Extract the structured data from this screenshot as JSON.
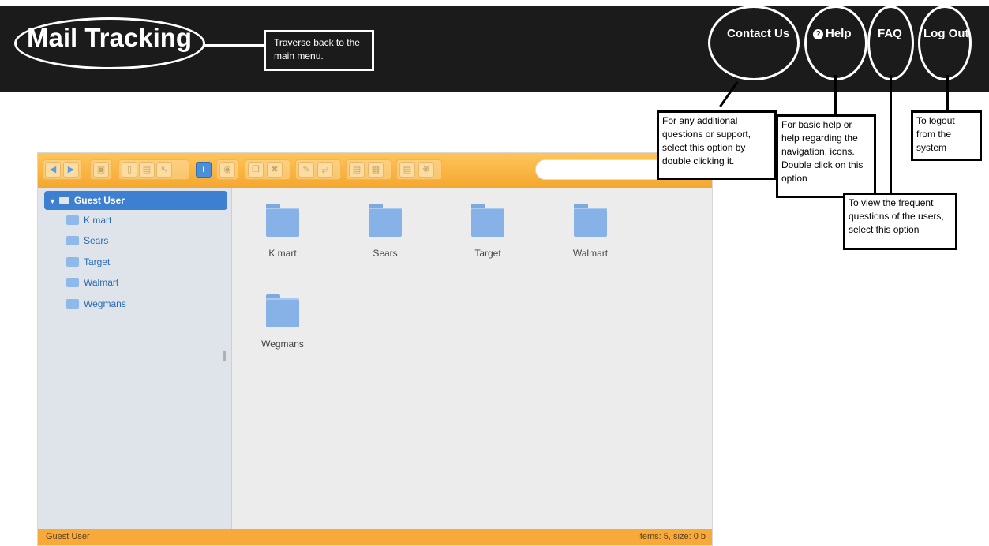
{
  "header": {
    "brand": "Mail Tracking",
    "brand_callout": "Traverse back to the main menu.",
    "nav": {
      "contact": "Contact Us",
      "help": "Help",
      "faq": "FAQ",
      "logout": "Log Out"
    }
  },
  "callouts": {
    "contact": "For any additional questions or support, select this option by double clicking it.",
    "help": "For basic help or help regarding the navigation, icons. Double click on this option",
    "faq": "To view the frequent questions of the users, select this option",
    "logout": "To logout from the system"
  },
  "file_manager": {
    "search": {
      "placeholder": "",
      "value": ""
    },
    "tree": {
      "root": "Guest User",
      "items": [
        "K mart",
        "Sears",
        "Target",
        "Walmart",
        "Wegmans"
      ]
    },
    "folders": [
      "K mart",
      "Sears",
      "Target",
      "Walmart",
      "Wegmans"
    ],
    "status": {
      "left": "Guest User",
      "right": "items: 5, size: 0 b"
    }
  },
  "colors": {
    "header_bg": "#1b1b1b",
    "toolbar": "#f4a72f",
    "statusbar": "#f7a93a",
    "tree_selected": "#3d7fd1",
    "folder": "#86b2e8"
  }
}
